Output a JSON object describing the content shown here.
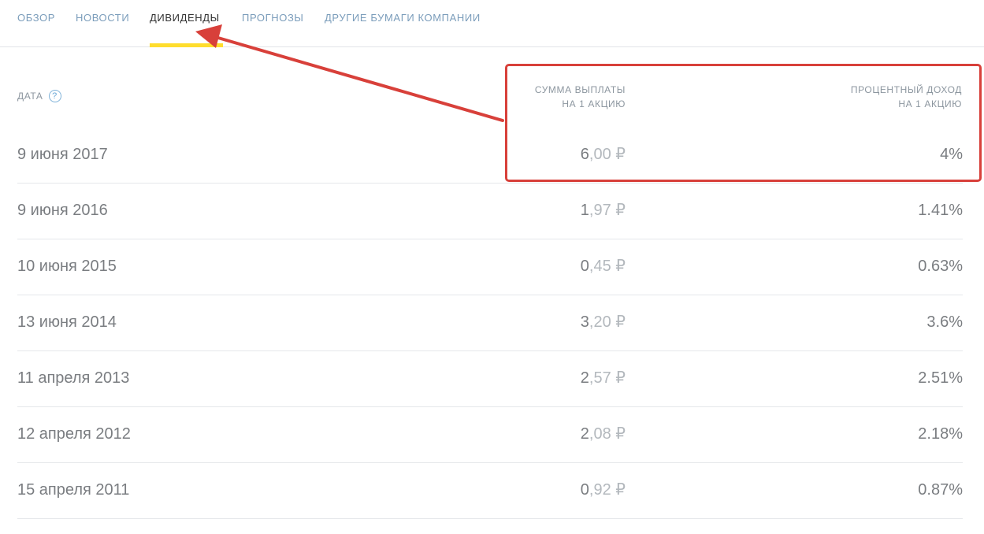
{
  "tabs": [
    {
      "label": "Обзор",
      "active": false
    },
    {
      "label": "Новости",
      "active": false
    },
    {
      "label": "Дивиденды",
      "active": true
    },
    {
      "label": "Прогнозы",
      "active": false
    },
    {
      "label": "Другие бумаги компании",
      "active": false
    }
  ],
  "table": {
    "headers": {
      "date": "Дата",
      "help_icon": "?",
      "amount_line1": "Сумма выплаты",
      "amount_line2": "на 1 акцию",
      "yield_line1": "Процентный доход",
      "yield_line2": "на 1 акцию"
    },
    "rows": [
      {
        "date": "9 июня 2017",
        "amount_int": "6",
        "amount_frac": ",00 ₽",
        "yield": "4%"
      },
      {
        "date": "9 июня 2016",
        "amount_int": "1",
        "amount_frac": ",97 ₽",
        "yield": "1.41%"
      },
      {
        "date": "10 июня 2015",
        "amount_int": "0",
        "amount_frac": ",45 ₽",
        "yield": "0.63%"
      },
      {
        "date": "13 июня 2014",
        "amount_int": "3",
        "amount_frac": ",20 ₽",
        "yield": "3.6%"
      },
      {
        "date": "11 апреля 2013",
        "amount_int": "2",
        "amount_frac": ",57 ₽",
        "yield": "2.51%"
      },
      {
        "date": "12 апреля 2012",
        "amount_int": "2",
        "amount_frac": ",08 ₽",
        "yield": "2.18%"
      },
      {
        "date": "15 апреля 2011",
        "amount_int": "0",
        "amount_frac": ",92 ₽",
        "yield": "0.87%"
      }
    ]
  },
  "colors": {
    "tab_inactive": "#7b9dbb",
    "tab_active": "#333333",
    "tab_underline": "#ffdd2d",
    "annotation": "#d8403a"
  }
}
